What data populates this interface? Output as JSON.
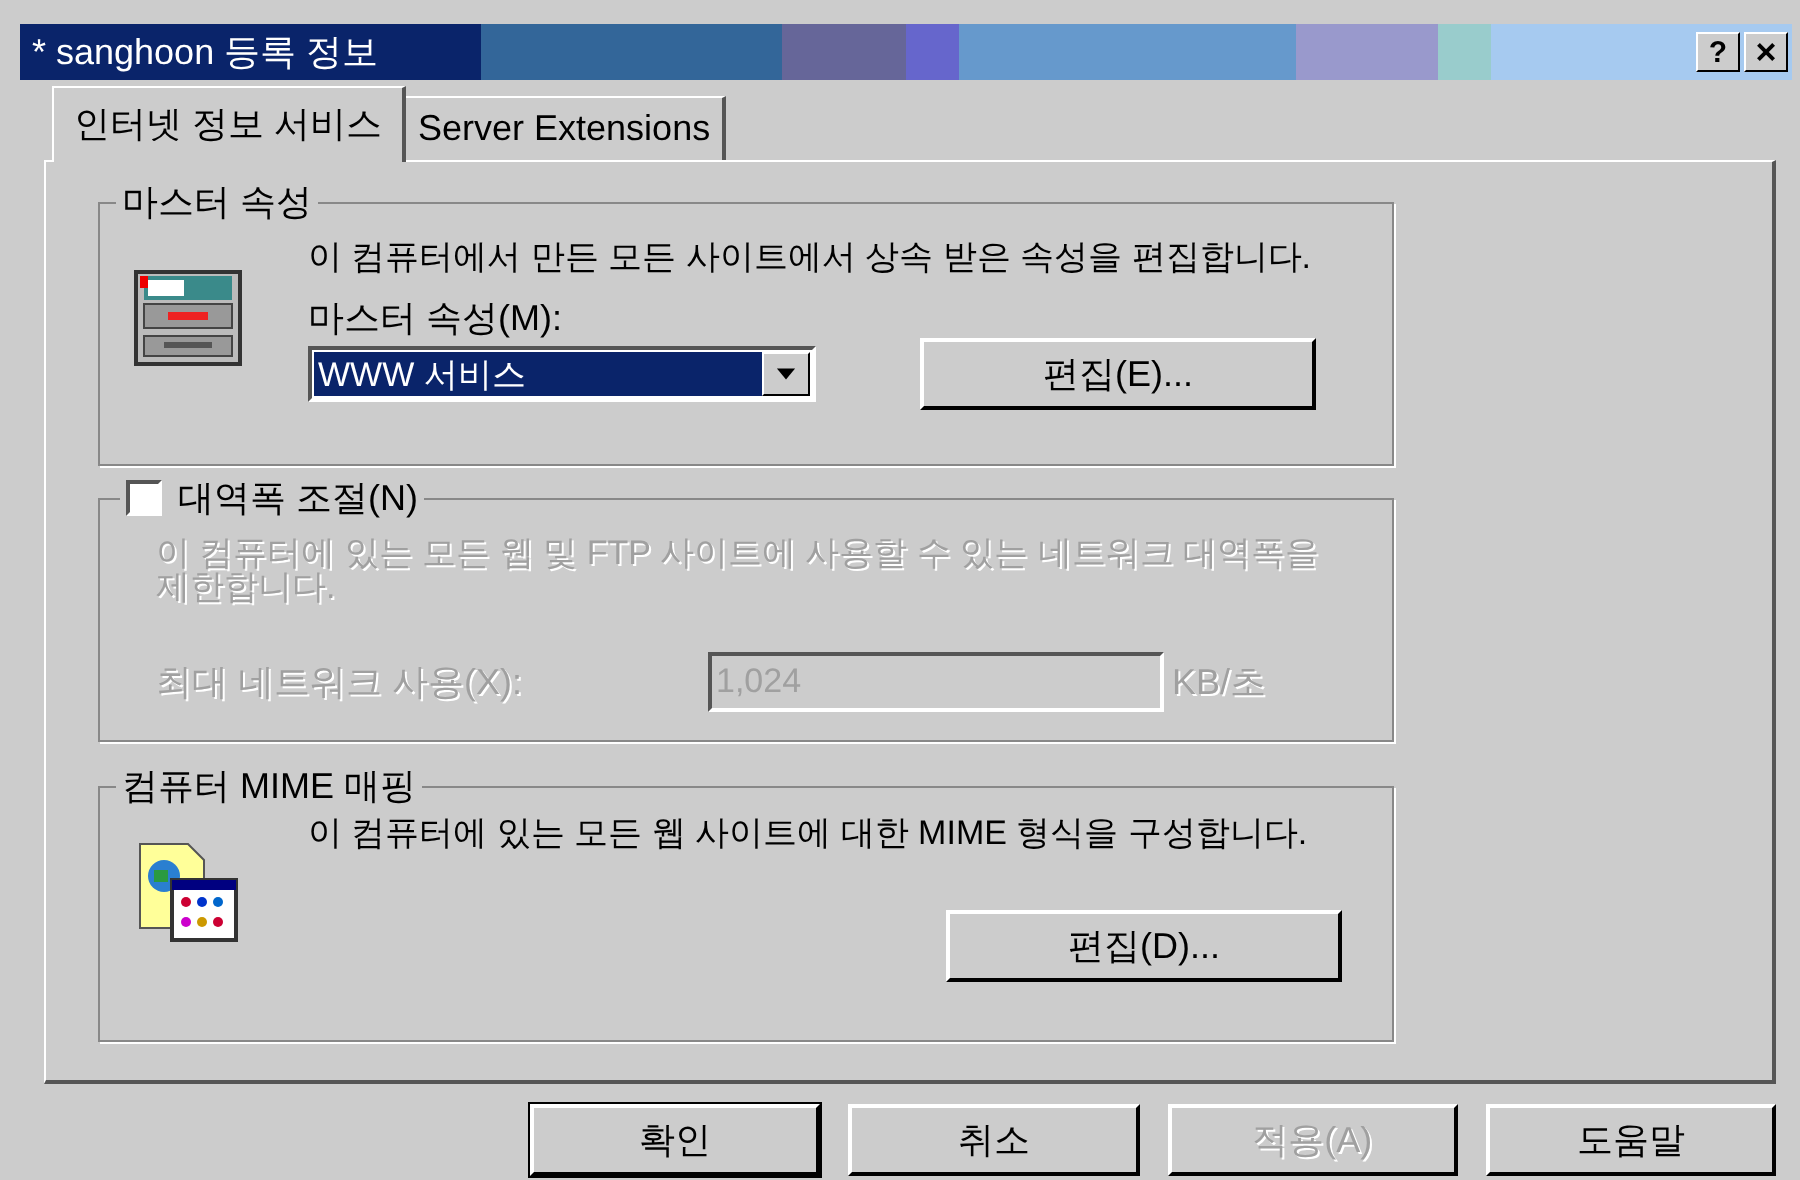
{
  "window": {
    "title": "* sanghoon 등록 정보",
    "help": "?",
    "close": "×"
  },
  "tabs": [
    {
      "label": "인터넷 정보 서비스",
      "selected": true
    },
    {
      "label": "Server Extensions",
      "selected": false
    }
  ],
  "master_properties": {
    "title": "마스터 속성",
    "description": "이 컴퓨터에서 만든 모든 사이트에서 상속 받은 속성을 편집합니다.",
    "field_label": "마스터 속성(M):",
    "dropdown": {
      "value": "WWW 서비스"
    },
    "edit_button": "편집(E)..."
  },
  "bandwidth": {
    "label": "대역폭 조절(N)",
    "checked": false,
    "description": "이 컴퓨터에 있는 모든 웹 및 FTP 사이트에 사용할 수 있는 네트워크 대역폭을 제한합니다.",
    "limit_label": "최대 네트워크 사용(X):",
    "limit_value": "1,024",
    "unit": "KB/초"
  },
  "mime": {
    "title": "컴퓨터 MIME 매핑",
    "description": "이 컴퓨터에 있는 모든 웹 사이트에 대한 MIME 형식을 구성합니다.",
    "edit_button": "편집(D)..."
  },
  "buttons": [
    {
      "label": "확인",
      "disabled": false,
      "default": true
    },
    {
      "label": "취소",
      "disabled": false,
      "default": false
    },
    {
      "label": "적용(A)",
      "disabled": true,
      "default": false
    },
    {
      "label": "도움말",
      "disabled": false,
      "default": false
    }
  ]
}
